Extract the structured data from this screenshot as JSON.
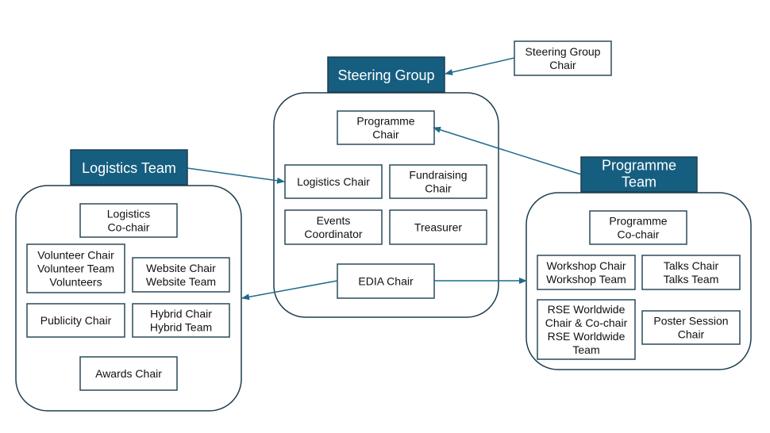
{
  "colors": {
    "header": "#165e80",
    "border": "#1d3d4f",
    "arrow": "#1f6a8a"
  },
  "steering": {
    "title": "Steering Group",
    "chair": [
      "Steering Group",
      "Chair"
    ],
    "boxes": {
      "programme_chair": [
        "Programme",
        "Chair"
      ],
      "logistics_chair": [
        "Logistics Chair"
      ],
      "fundraising_chair": [
        "Fundraising",
        "Chair"
      ],
      "events_coordinator": [
        "Events",
        "Coordinator"
      ],
      "treasurer": [
        "Treasurer"
      ],
      "edia_chair": [
        "EDIA Chair"
      ]
    }
  },
  "logistics": {
    "title": "Logistics Team",
    "boxes": {
      "co_chair": [
        "Logistics",
        "Co-chair"
      ],
      "volunteer": [
        "Volunteer Chair",
        "Volunteer Team",
        "Volunteers"
      ],
      "website": [
        "Website Chair",
        "Website Team"
      ],
      "publicity": [
        "Publicity Chair"
      ],
      "hybrid": [
        "Hybrid Chair",
        "Hybrid Team"
      ],
      "awards": [
        "Awards Chair"
      ]
    }
  },
  "programme": {
    "title": [
      "Programme",
      "Team"
    ],
    "boxes": {
      "co_chair": [
        "Programme",
        "Co-chair"
      ],
      "workshop": [
        "Workshop Chair",
        "Workshop Team"
      ],
      "talks": [
        "Talks Chair",
        "Talks Team"
      ],
      "rse": [
        "RSE Worldwide",
        "Chair & Co-chair",
        "RSE Worldwide",
        "Team"
      ],
      "poster": [
        "Poster Session",
        "Chair"
      ]
    }
  }
}
